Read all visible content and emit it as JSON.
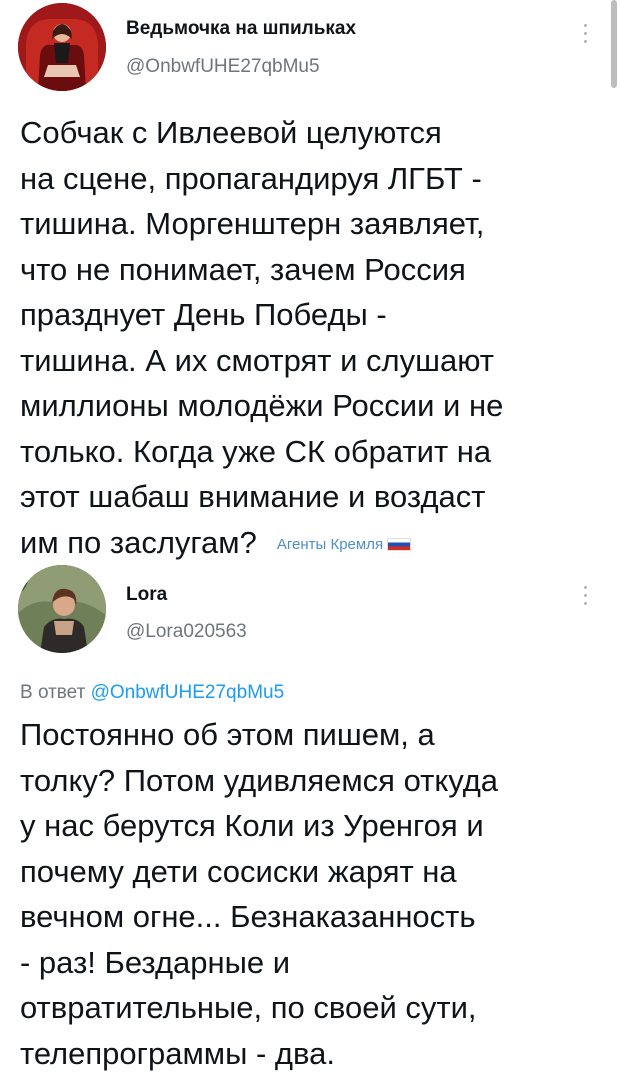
{
  "posts": [
    {
      "author_name": "Ведьмочка на шпильках",
      "author_handle": "@OnbwfUHE27qbMu5",
      "body_lines": [
        "Собчак с Ивлеевой целуются",
        "на сцене, пропагандируя ЛГБТ -",
        "тишина. Моргенштерн заявляет,",
        "что не понимает, зачем Россия",
        "празднует День Победы -",
        "тишина. А их смотрят и слушают",
        "миллионы молодёжи России и не",
        "только. Когда уже СК обратит на",
        "этот шабаш внимание и воздаст",
        "им по заслугам?"
      ],
      "watermark": "Агенты Кремля"
    },
    {
      "author_name": "Lora",
      "author_handle": "@Lora020563",
      "reply_prefix": "В ответ",
      "reply_mention": "@OnbwfUHE27qbMu5",
      "body_lines": [
        "Постоянно об этом пишем, а",
        "толку? Потом удивляемся откуда",
        "у нас берутся Коли из Уренгоя и",
        "почему дети сосиски жарят на",
        "вечном огне... Безнаказанность",
        "- раз! Бездарные и",
        "отвратительные, по своей сути,",
        "телепрограммы - два."
      ]
    }
  ],
  "icons": {
    "more": "more-vertical-icon",
    "flag": "russian-flag-icon"
  },
  "colors": {
    "text": "#0f1419",
    "secondary": "#6e767d",
    "link": "#1d9bf0",
    "watermark": "#4d8ec9"
  }
}
